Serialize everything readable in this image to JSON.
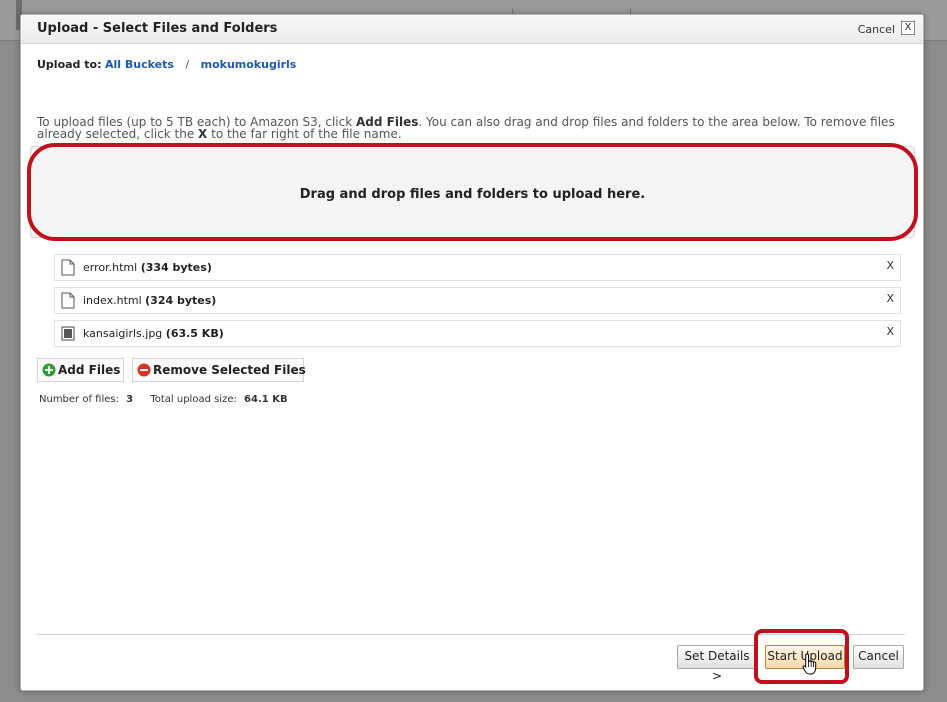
{
  "dialog": {
    "title": "Upload - Select Files and Folders",
    "header_cancel": "Cancel",
    "close_glyph": "X"
  },
  "upload_to": {
    "label": "Upload to:",
    "breadcrumb": [
      {
        "label": "All Buckets"
      },
      {
        "label": "mokumokugirls"
      }
    ],
    "separator": "/"
  },
  "instructions": {
    "part1": "To upload files (up to 5 TB each) to Amazon S3, click ",
    "add_files": "Add Files",
    "part2": ". You can also drag and drop files and folders to the area below. To remove files already selected, click the ",
    "x": "X",
    "part3": " to the far right of the file name."
  },
  "dropzone": {
    "text": "Drag and drop files and folders to upload here.",
    "highlight_color": "#c0121e"
  },
  "files": [
    {
      "name": "error.html",
      "size": "(334 bytes)",
      "icon": "document-icon",
      "remove": "X"
    },
    {
      "name": "index.html",
      "size": "(324 bytes)",
      "icon": "document-icon",
      "remove": "X"
    },
    {
      "name": "kansaigirls.jpg",
      "size": "(63.5 KB)",
      "icon": "image-icon",
      "remove": "X"
    }
  ],
  "actions": {
    "add_files": "Add Files",
    "remove_selected": "Remove Selected Files"
  },
  "summary": {
    "files_label": "Number of files:",
    "files_value": "3",
    "size_label": "Total upload size:",
    "size_value": "64.1 KB"
  },
  "footer": {
    "set_details": "Set Details >",
    "start_upload": "Start Upload",
    "cancel": "Cancel"
  },
  "colors": {
    "link": "#1e5aa8",
    "highlight": "#c0121e",
    "add_icon": "#2e9e2e",
    "remove_icon": "#d9361f"
  }
}
